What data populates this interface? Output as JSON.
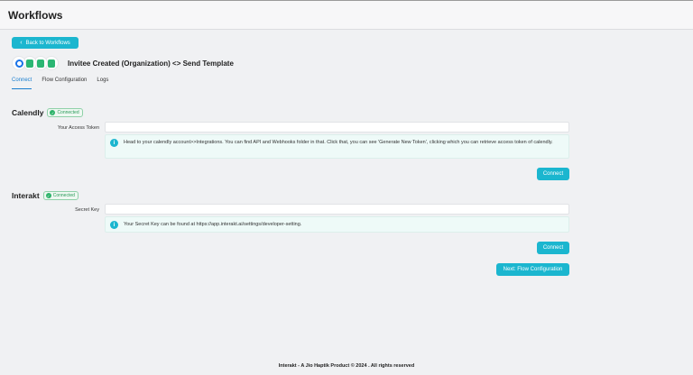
{
  "header": {
    "title": "Workflows"
  },
  "back_button": {
    "label": "Back to Workflows"
  },
  "workflow": {
    "name": "Invitee Created (Organization) <> Send Template",
    "icons": [
      "calendly-icon",
      "whatsapp-template-icon",
      "whatsapp-template-icon",
      "whatsapp-template-icon"
    ]
  },
  "tabs": [
    {
      "label": "Connect",
      "active": true
    },
    {
      "label": "Flow Configuration",
      "active": false
    },
    {
      "label": "Logs",
      "active": false
    }
  ],
  "calendly": {
    "title": "Calendly",
    "status": "Connected",
    "field_label": "Your Access Token",
    "field_value": "",
    "info_text": "Head to your calendly account>>Integrations. You can find API and Webhooks folder in that. Click that, you can see 'Generate New Token', clicking which you can retrieve access token of calendly.",
    "connect_label": "Connect"
  },
  "interakt": {
    "title": "Interakt",
    "status": "Connected",
    "field_label": "Secret Key",
    "field_value": "",
    "info_text": "Your Secret Key can be found at https://app.interakt.ai/settings/developer-setting.",
    "connect_label": "Connect"
  },
  "next_button": {
    "label": "Next: Flow Configuration"
  },
  "footer": {
    "text": "Interakt - A Jio Haptik Product © 2024 . All rights reserved"
  },
  "colors": {
    "accent": "#1bb6cf",
    "tab_active": "#1a7fcf",
    "connected": "#2eb36a"
  }
}
